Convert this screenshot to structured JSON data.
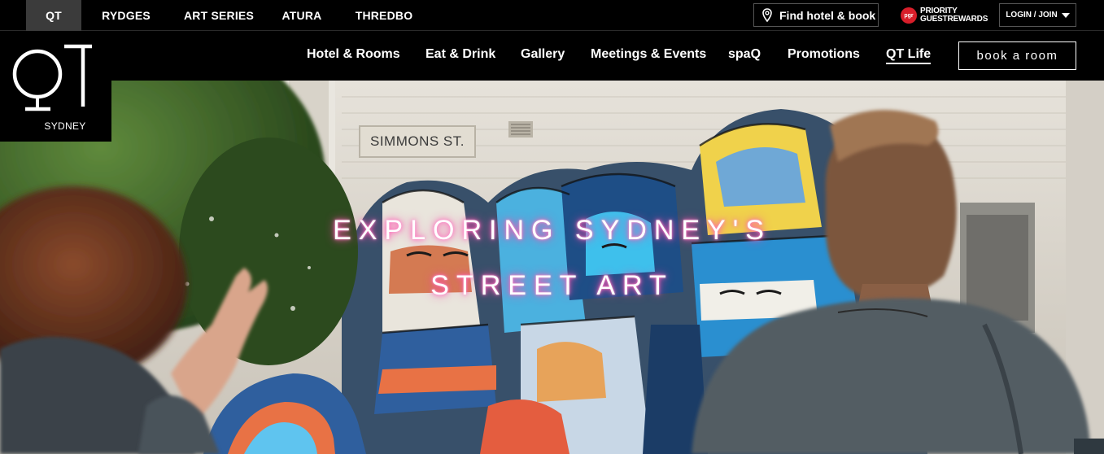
{
  "brand_tabs": [
    {
      "label": "QT",
      "active": true
    },
    {
      "label": "RYDGES",
      "active": false
    },
    {
      "label": "ART SERIES",
      "active": false
    },
    {
      "label": "ATURA",
      "active": false
    },
    {
      "label": "THREDBO",
      "active": false
    }
  ],
  "topbar": {
    "find_hotel_label": "Find hotel & book",
    "find_hotel_icon": "location-pin-icon",
    "priority_logo_text": "pgr",
    "priority_line1": "PRIORITY",
    "priority_line2": "GUESTREWARDS",
    "login_label": "LOGIN / JOIN"
  },
  "logo": {
    "city": "SYDNEY"
  },
  "nav": {
    "items": [
      {
        "label": "Hotel & Rooms"
      },
      {
        "label": "Eat & Drink"
      },
      {
        "label": "Gallery"
      },
      {
        "label": "Meetings & Events"
      },
      {
        "label": "spaQ"
      },
      {
        "label": "Promotions"
      },
      {
        "label": "QT Life",
        "active": true
      }
    ],
    "book_label": "book a room"
  },
  "hero": {
    "title_line1": "EXPLORING SYDNEY'S",
    "title_line2": "STREET ART",
    "street_sign": "SIMMONS  ST."
  },
  "colors": {
    "background": "#000000",
    "active_tab": "#3b3b3b",
    "neon_glow": "#ff3ea5",
    "pgr_red": "#d81e2a"
  }
}
